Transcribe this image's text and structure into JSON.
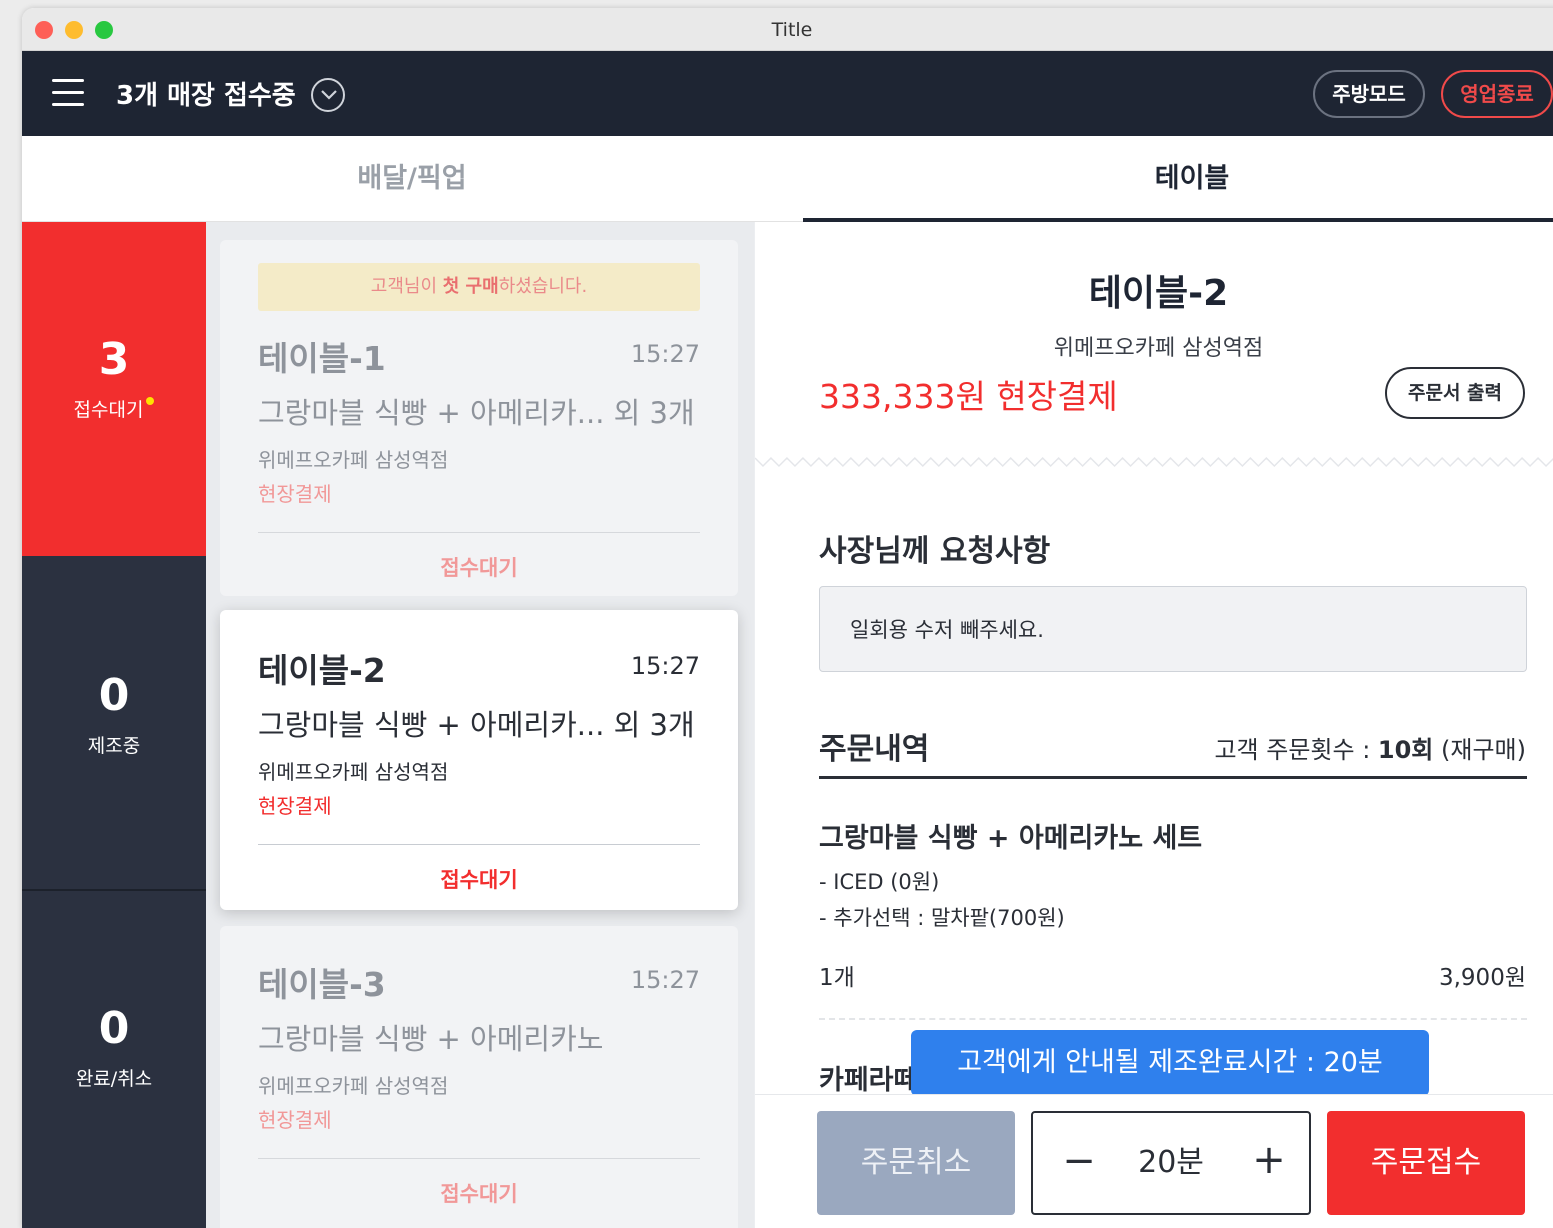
{
  "window": {
    "title": "Title"
  },
  "header": {
    "store_status": "3개 매장 접수중",
    "kitchen_mode_label": "주방모드",
    "close_business_label": "영업종료"
  },
  "tabs": [
    {
      "label": "배달/픽업",
      "active": false
    },
    {
      "label": "테이블",
      "active": true
    }
  ],
  "status_sidebar": [
    {
      "count": "3",
      "label": "접수대기",
      "active": true,
      "has_alert_dot": true
    },
    {
      "count": "0",
      "label": "제조중",
      "active": false
    },
    {
      "count": "0",
      "label": "완료/취소",
      "active": false
    }
  ],
  "orders": [
    {
      "notice_prefix": "고객님이 ",
      "notice_highlight": "첫 구매",
      "notice_suffix": "하셨습니다.",
      "title": "테이블-1",
      "time": "15:27",
      "items": "그랑마블 식빵 + 아메리카... 외 3개",
      "store": "위메프오카페 삼성역점",
      "payment": "현장결제",
      "status": "접수대기"
    },
    {
      "title": "테이블-2",
      "time": "15:27",
      "items": "그랑마블 식빵 + 아메리카... 외 3개",
      "store": "위메프오카페 삼성역점",
      "payment": "현장결제",
      "status": "접수대기",
      "selected": true
    },
    {
      "title": "테이블-3",
      "time": "15:27",
      "items": "그랑마블 식빵 + 아메리카노",
      "store": "위메프오카페 삼성역점",
      "payment": "현장결제",
      "status": "접수대기"
    }
  ],
  "detail": {
    "title": "테이블-2",
    "store": "위메프오카페 삼성역점",
    "price_payment": "333,333원 현장결제",
    "print_button": "주문서 출력",
    "request_heading": "사장님께 요청사항",
    "request_text": "일회용 수저 빼주세요.",
    "order_heading": "주문내역",
    "customer_count_label": "고객 주문횟수 : ",
    "customer_count_value": "10회",
    "customer_count_suffix": " (재구매)",
    "items": [
      {
        "name": "그랑마블 식빵 + 아메리카노 세트",
        "options": [
          "- ICED (0원)",
          "- 추가선택 : 말차팥(700원)"
        ],
        "quantity": "1개",
        "price": "3,900원"
      },
      {
        "name_partial": "카페라떼"
      }
    ]
  },
  "tooltip": {
    "text": "고객에게 안내될 제조완료시간 : 20분"
  },
  "actions": {
    "cancel_label": "주문취소",
    "time_value": "20분",
    "minus_symbol": "−",
    "plus_symbol": "+",
    "accept_label": "주문접수"
  },
  "colors": {
    "header_bg": "#1e2533",
    "accent_red": "#f22e2e",
    "tooltip_blue": "#2f80ed",
    "cancel_gray": "#9aa8bf"
  }
}
